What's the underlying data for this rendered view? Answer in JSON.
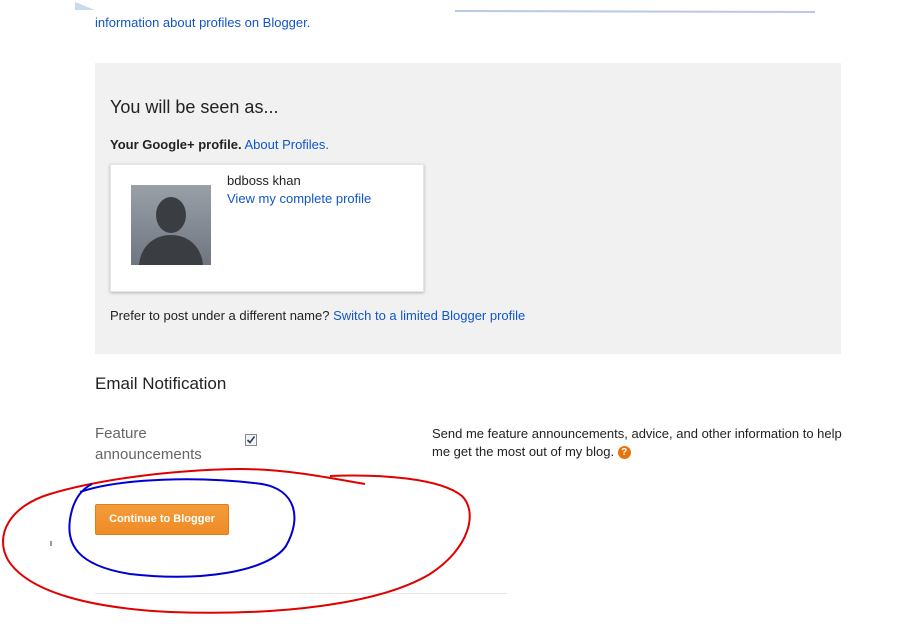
{
  "header": {
    "profiles_info_link": "information about profiles on Blogger."
  },
  "seen_as": {
    "title": "You will be seen as...",
    "profile_label": "Your Google+ profile.",
    "about_profiles_link": "About Profiles.",
    "profile_name": "bdboss khan",
    "view_profile_link": "View my complete profile",
    "prefer_text": "Prefer to post under a different name?",
    "switch_link": "Switch to a limited Blogger profile"
  },
  "email_notification": {
    "heading": "Email Notification",
    "feature_label": "Feature announcements",
    "feature_checked": true,
    "feature_description": "Send me feature announcements, advice, and other information to help me get the most out of my blog.",
    "help_icon": "?"
  },
  "actions": {
    "continue_label": "Continue to Blogger"
  },
  "colors": {
    "link": "#1155cc",
    "panel_bg": "#f1f1f1",
    "button_orange": "#f08b25",
    "annotation_red": "#e00000",
    "annotation_blue": "#0000d0"
  }
}
